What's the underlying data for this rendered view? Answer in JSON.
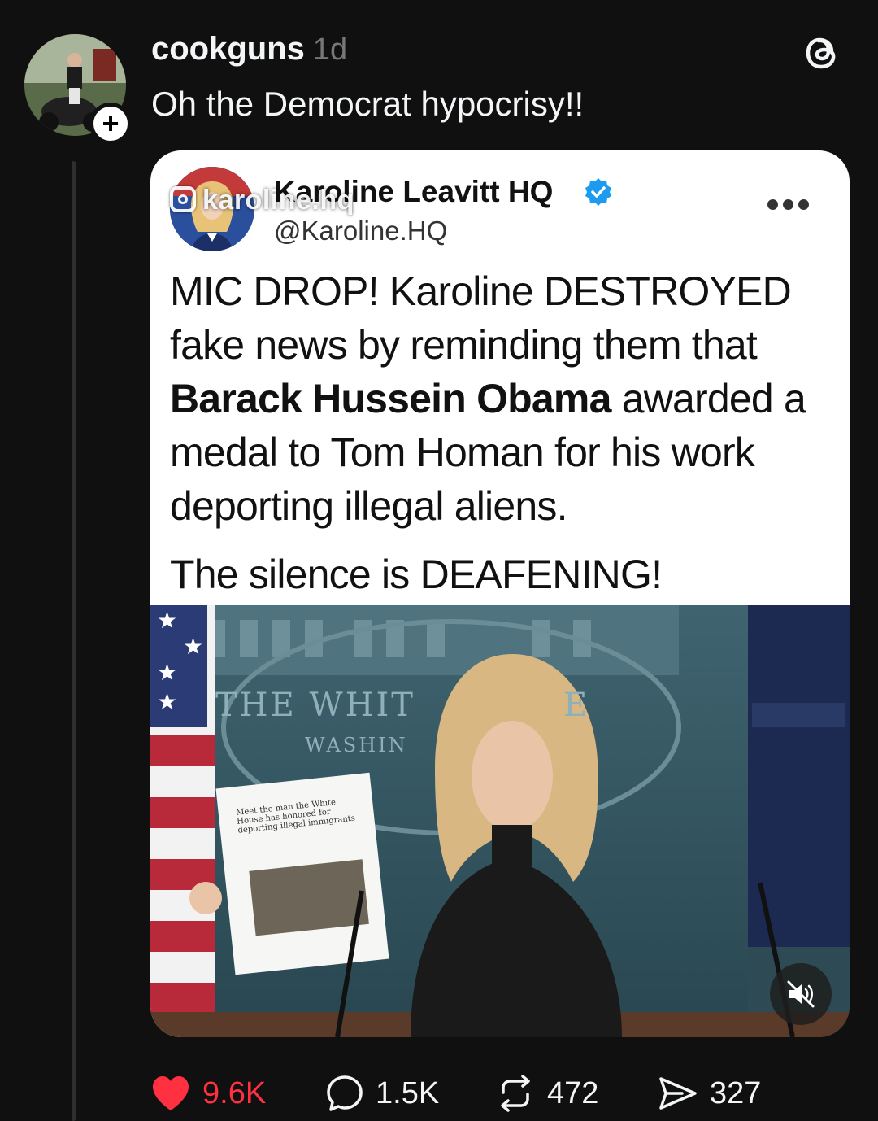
{
  "post": {
    "username": "cookguns",
    "time": "1d",
    "caption": "Oh the Democrat hypocrisy!!"
  },
  "embedded": {
    "watermark": "karoline.hq",
    "display_name": "Karoline Leavitt HQ",
    "handle": "@Karoline.HQ",
    "text_part1": "MIC DROP! Karoline DESTROYED fake news by reminding them that ",
    "text_bold": "Barack Hussein Obama",
    "text_part2": " awarded a medal to Tom Homan for his work deporting illegal aliens.",
    "text_line2": "The silence is DEAFENING!"
  },
  "video": {
    "backdrop_text": "THE WHIT",
    "backdrop_text_2": "E",
    "backdrop_sub": "WASHIN",
    "paper_headline": "Meet the man the White House has honored for deporting illegal immigrants"
  },
  "actions": {
    "likes": "9.6K",
    "replies": "1.5K",
    "reposts": "472",
    "shares": "327"
  },
  "colors": {
    "background": "#101010",
    "like": "#ff3040",
    "verified": "#1d9bf0"
  }
}
